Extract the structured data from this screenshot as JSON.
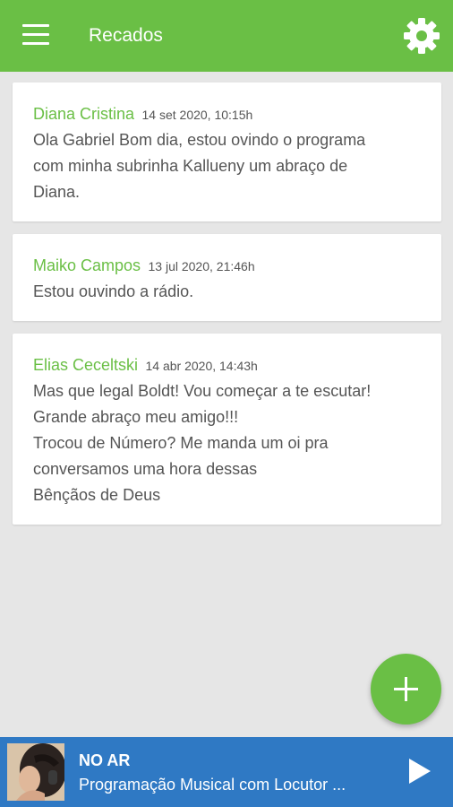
{
  "app_bar": {
    "title": "Recados",
    "background_color": "#6abf45",
    "icons": [
      "menu-icon",
      "gear-icon"
    ]
  },
  "messages": [
    {
      "author": "Diana Cristina",
      "date": "14 set 2020, 10:15h",
      "text": "Ola Gabriel Bom dia, estou ovindo o programa\ncom minha subrinha Kallueny um abraço de\nDiana."
    },
    {
      "author": "Maiko Campos",
      "date": "13 jul 2020, 21:46h",
      "text": "Estou ouvindo a rádio."
    },
    {
      "author": "Elias Ceceltski",
      "date": "14 abr 2020, 14:43h",
      "text": "Mas que legal Boldt! Vou começar a te escutar!\nGrande abraço meu amigo!!!\nTrocou de Número? Me manda um oi pra\nconversamos uma hora dessas\nBênçãos de Deus"
    }
  ],
  "fab": {
    "icon": "plus-icon",
    "color": "#6abf45"
  },
  "player": {
    "status": "NO AR",
    "program": "Programação Musical com Locutor ...",
    "background_color": "#2f79c4",
    "icon": "play-icon"
  },
  "colors": {
    "accent_green": "#6abf45",
    "player_blue": "#2f79c4",
    "page_background": "#e6e6e6",
    "body_text": "#555555"
  }
}
